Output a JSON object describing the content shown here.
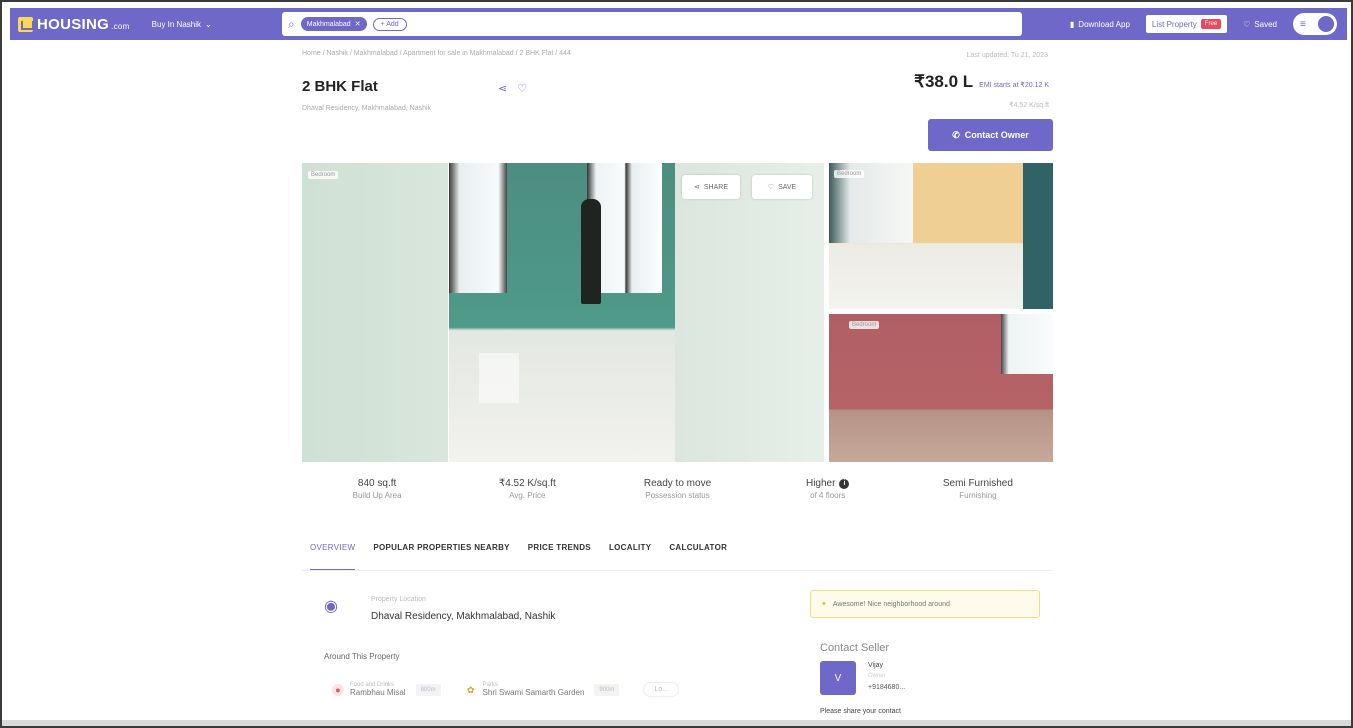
{
  "header": {
    "logo": "HOUSING",
    "logo_suffix": ".com",
    "buy_in": "Buy In Nashik",
    "search_chip": "Makhmalabad",
    "search_add": "+ Add",
    "download_app": "Download App",
    "list_property": "List Property",
    "free_badge": "Free",
    "saved": "Saved"
  },
  "listing": {
    "breadcrumb": "Home / Nashik / Makhmalabad / Apartment for sale in Makhmalabad / 2 BHK Flat / 444",
    "last_updated": "Last updated: Tu 21, 2023",
    "title": "2 BHK Flat",
    "subtitle": "Dhaval Residency, Makhmalabad, Nashik",
    "price": "₹38.0 L",
    "emi": "EMI starts at ₹20.12 K",
    "per_sqft": "₹4.52 K/sq.ft",
    "contact_owner": "Contact Owner"
  },
  "gallery": {
    "main_tag": "Bedroom",
    "share": "SHARE",
    "save": "SAVE",
    "thumb1_tag": "Bedroom",
    "thumb2_tag": "Bedroom"
  },
  "stats": [
    {
      "value": "840 sq.ft",
      "label": "Build Up Area"
    },
    {
      "value": "₹4.52 K/sq.ft",
      "label": "Avg. Price"
    },
    {
      "value": "Ready to move",
      "label": "Possession status"
    },
    {
      "value": "Higher",
      "label": "of 4 floors"
    },
    {
      "value": "Semi Furnished",
      "label": "Furnishing"
    }
  ],
  "tabs": [
    "OVERVIEW",
    "POPULAR PROPERTIES NEARBY",
    "PRICE TRENDS",
    "LOCALITY",
    "CALCULATOR"
  ],
  "location": {
    "label": "Property Location",
    "value": "Dhaval Residency, Makhmalabad, Nashik",
    "around": "Around This Property",
    "nearby": [
      {
        "category": "Food and Drinks",
        "name": "Rambhau Misal",
        "distance": "800m"
      },
      {
        "category": "Parks",
        "name": "Shri Swami Samarth Garden",
        "distance": "900m"
      }
    ],
    "more": "Lo..."
  },
  "seller": {
    "awesome": "Awesome! Nice neighborhood around",
    "heading": "Contact Seller",
    "avatar": "V",
    "name": "Vijay",
    "role": "Owner",
    "phone": "+9184680...",
    "share_contact": "Please share your contact"
  },
  "colors": {
    "brand": "#6e68c9",
    "free_badge": "#e8495c",
    "logo_mark": "#fdd857"
  }
}
